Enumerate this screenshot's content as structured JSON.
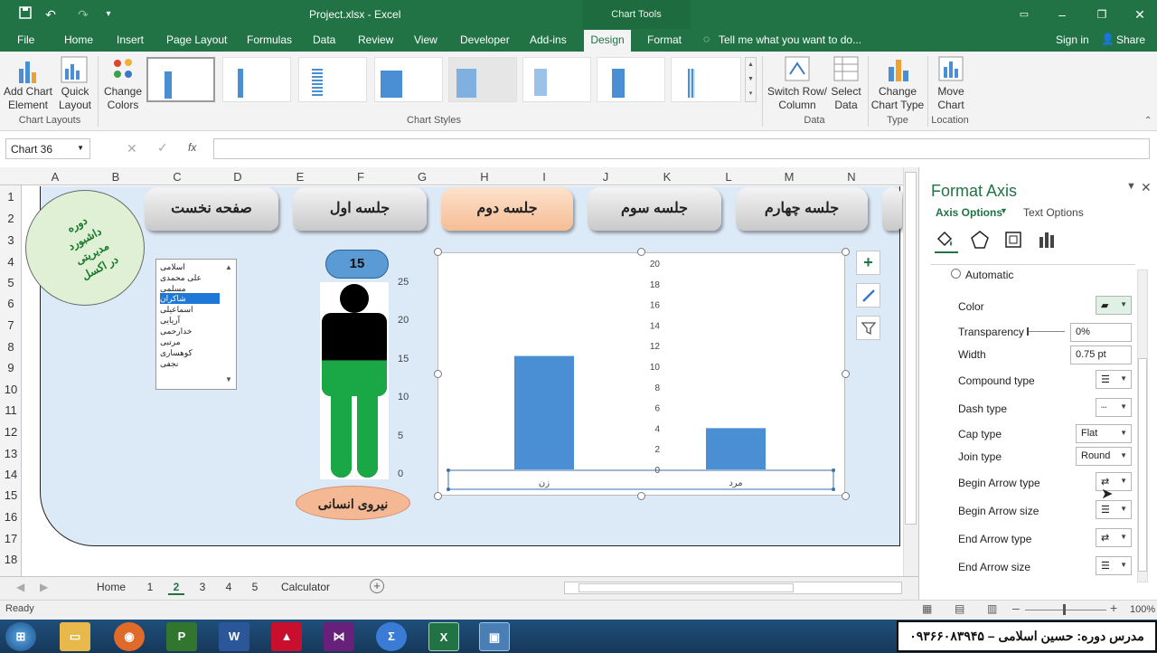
{
  "window": {
    "title": "Project.xlsx - Excel",
    "context_tab": "Chart Tools",
    "quick_access": [
      "save-icon",
      "undo-icon",
      "redo-icon",
      "customize-icon"
    ]
  },
  "tabs": [
    "File",
    "Home",
    "Insert",
    "Page Layout",
    "Formulas",
    "Data",
    "Review",
    "View",
    "Developer",
    "Add-ins",
    "Design",
    "Format"
  ],
  "tell_me": "Tell me what you want to do...",
  "account": {
    "signin": "Sign in",
    "share": "Share"
  },
  "ribbon": {
    "add_chart_element": "Add Chart Element",
    "quick_layout": "Quick Layout",
    "change_colors": "Change Colors",
    "switch_row_column": "Switch Row/ Column",
    "select_data": "Select Data",
    "change_chart_type": "Change Chart Type",
    "move_chart": "Move Chart",
    "groups": {
      "chart_layouts": "Chart Layouts",
      "chart_styles": "Chart Styles",
      "data": "Data",
      "type": "Type",
      "location": "Location"
    }
  },
  "formula": {
    "name_box": "Chart 36",
    "fx": "fx",
    "value": ""
  },
  "columns": [
    "A",
    "B",
    "C",
    "D",
    "E",
    "F",
    "G",
    "H",
    "I",
    "J",
    "K",
    "L",
    "M",
    "N"
  ],
  "rows": [
    "1",
    "2",
    "3",
    "4",
    "5",
    "6",
    "7",
    "8",
    "9",
    "10",
    "11",
    "12",
    "13",
    "14",
    "15",
    "16",
    "17",
    "18"
  ],
  "dashboard": {
    "nav": [
      "صفحه نخست",
      "جلسه اول",
      "جلسه دوم",
      "جلسه سوم",
      "جلسه چهارم"
    ],
    "active_nav": "جلسه دوم",
    "logo_lines": [
      "دوره",
      "داشبورد مدیریتی",
      "در اکسل"
    ],
    "list_items": [
      "اسلامی",
      "علی محمدی",
      "مسلمی",
      "شاکران",
      "اسماعیلی",
      "آریایی",
      "خدارحمی",
      "مرتبی",
      "کوهساری",
      "نجفی"
    ],
    "selected_list_item": "شاکران",
    "count_label": "15",
    "person_axis": [
      "25",
      "20",
      "15",
      "10",
      "5",
      "0"
    ],
    "person_fill_value": 15,
    "person_axis_max": 25,
    "hr_label": "نیروی انسانی"
  },
  "chart_data": {
    "type": "bar",
    "categories": [
      "زن",
      "مرد"
    ],
    "values": [
      11,
      4
    ],
    "ylim": [
      0,
      20
    ],
    "yticks": [
      "0",
      "2",
      "4",
      "6",
      "8",
      "10",
      "12",
      "14",
      "16",
      "18",
      "20"
    ],
    "color": "#4a8fd4"
  },
  "sheet_tabs": [
    "Home",
    "1",
    "2",
    "3",
    "4",
    "5",
    "Calculator"
  ],
  "active_sheet": "2",
  "status": {
    "ready": "Ready",
    "zoom": "100%"
  },
  "pane": {
    "title": "Format Axis",
    "tab_axis": "Axis Options",
    "tab_text": "Text Options",
    "automatic": "Automatic",
    "color": "Color",
    "transparency": "Transparency",
    "transparency_value": "0%",
    "width": "Width",
    "width_value": "0.75 pt",
    "compound": "Compound type",
    "dash": "Dash type",
    "cap": "Cap type",
    "cap_value": "Flat",
    "join": "Join type",
    "join_value": "Round",
    "begin_arrow_type": "Begin Arrow type",
    "begin_arrow_size": "Begin Arrow size",
    "end_arrow_type": "End Arrow type",
    "end_arrow_size": "End Arrow size"
  },
  "taskbar": {
    "apps": [
      "windows-start",
      "file-explorer",
      "firefox",
      "project",
      "word",
      "autocad",
      "visual-studio",
      "calculator",
      "excel",
      "screen-capture"
    ],
    "teacher": "مدرس دوره: حسین اسلامی – ۰۹۳۶۶۰۸۳۹۴۵"
  }
}
